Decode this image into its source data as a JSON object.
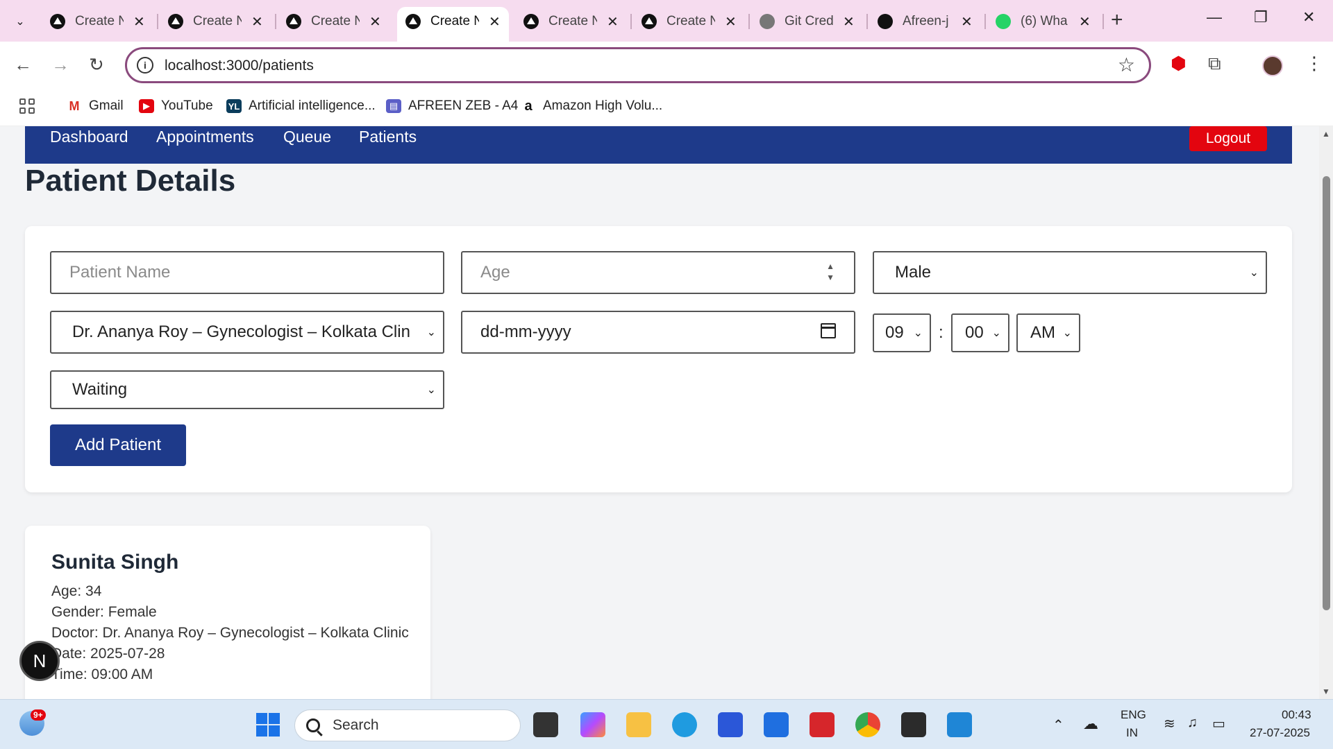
{
  "browser": {
    "tabs": [
      {
        "title": "Create N",
        "icon": "vercel-icon"
      },
      {
        "title": "Create N",
        "icon": "vercel-icon"
      },
      {
        "title": "Create N",
        "icon": "vercel-icon"
      },
      {
        "title": "Create N",
        "icon": "vercel-icon",
        "active": true
      },
      {
        "title": "Create N",
        "icon": "vercel-icon"
      },
      {
        "title": "Create N",
        "icon": "vercel-icon"
      },
      {
        "title": "Git Cred",
        "icon": "globe-icon"
      },
      {
        "title": "Afreen-j",
        "icon": "github-icon"
      },
      {
        "title": "(6) Wha",
        "icon": "whatsapp-icon"
      }
    ],
    "url": "localhost:3000/patients",
    "bookmarks": [
      {
        "label": "Gmail",
        "icon": "gmail-icon"
      },
      {
        "label": "YouTube",
        "icon": "youtube-icon"
      },
      {
        "label": "Artificial intelligence...",
        "icon": "yl-icon"
      },
      {
        "label": "AFREEN ZEB - A4",
        "icon": "printer-icon"
      },
      {
        "label": "Amazon High Volu...",
        "icon": "amazon-icon"
      }
    ]
  },
  "nav": {
    "links": [
      "Dashboard",
      "Appointments",
      "Queue",
      "Patients"
    ],
    "logout": "Logout",
    "color": "#1e3a8a",
    "logout_color": "#e3050f"
  },
  "page": {
    "title": "Patient Details"
  },
  "form": {
    "name_placeholder": "Patient Name",
    "age_placeholder": "Age",
    "gender": "Male",
    "doctor": "Dr. Ananya Roy – Gynecologist – Kolkata Clin",
    "date_placeholder": "dd-mm-yyyy",
    "hour": "09",
    "minute": "00",
    "ampm": "AM",
    "colon": ":",
    "status": "Waiting",
    "submit": "Add Patient"
  },
  "patients": [
    {
      "name": "Sunita Singh",
      "age_line": "Age: 34",
      "gender_line": "Gender: Female",
      "doctor_line": "Doctor: Dr. Ananya Roy – Gynecologist – Kolkata Clinic",
      "date_line": "Date: 2025-07-28",
      "time_line": "Time: 09:00 AM"
    }
  ],
  "next_badge": "N",
  "taskbar": {
    "search": "Search",
    "lang_top": "ENG",
    "lang_bottom": "IN",
    "time": "00:43",
    "date": "27-07-2025",
    "weather_badge": "9+"
  }
}
